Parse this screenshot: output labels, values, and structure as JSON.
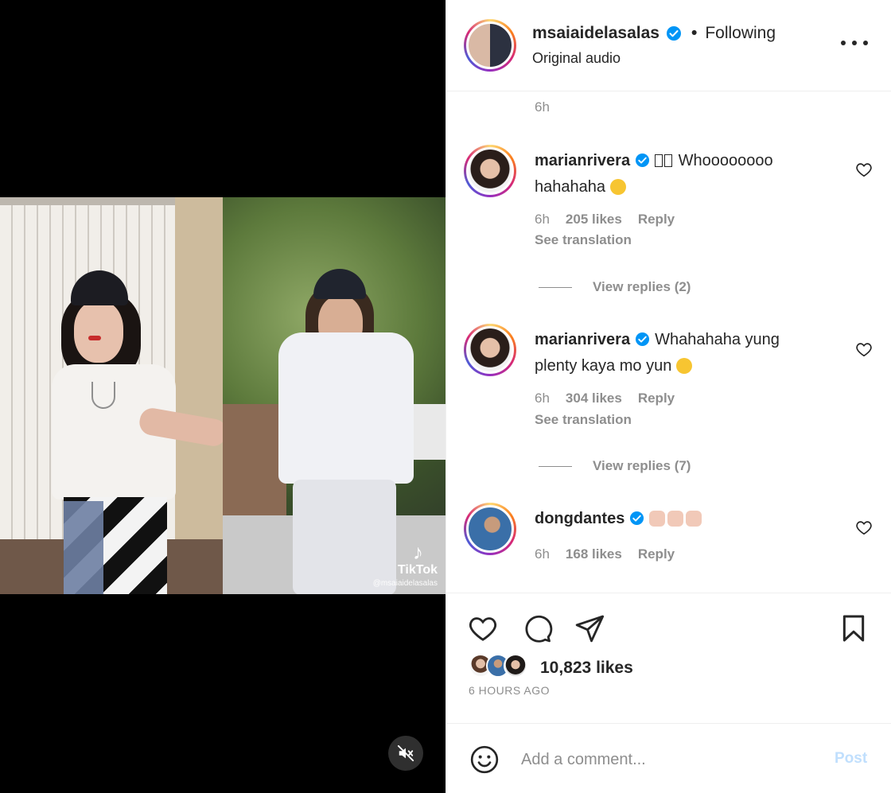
{
  "video": {
    "watermark_label": "TikTok",
    "watermark_handle": "@msaiaidelasalas",
    "mute_icon": "speaker-muted-icon"
  },
  "post": {
    "author": "msaiaidelasalas",
    "separator": "•",
    "follow_status": "Following",
    "audio": "Original audio",
    "more_icon": "more-horizontal-icon"
  },
  "comments": {
    "previous_time": "6h",
    "items": [
      {
        "user": "marianrivera",
        "text_line1": "Whoooooooo",
        "text_line2": "hahahaha",
        "time": "6h",
        "likes": "205 likes",
        "reply": "Reply",
        "translate": "See translation",
        "view_replies": "View replies (2)"
      },
      {
        "user": "marianrivera",
        "text_line1": "Whahahaha yung",
        "text_line2": "plenty kaya mo yun",
        "time": "6h",
        "likes": "304 likes",
        "reply": "Reply",
        "translate": "See translation",
        "view_replies": "View replies (7)"
      },
      {
        "user": "dongdantes",
        "text_line1": "",
        "time": "6h",
        "likes": "168 likes",
        "reply": "Reply"
      }
    ]
  },
  "actions": {
    "like_icon": "heart-icon",
    "comment_icon": "comment-icon",
    "share_icon": "send-icon",
    "save_icon": "bookmark-icon",
    "likes": "10,823 likes",
    "time": "6 HOURS AGO"
  },
  "comment_box": {
    "placeholder": "Add a comment...",
    "post_label": "Post"
  },
  "colors": {
    "verified": "#0095f6",
    "muted_text": "#8e8e8e",
    "post_disabled": "#c0dffd"
  }
}
